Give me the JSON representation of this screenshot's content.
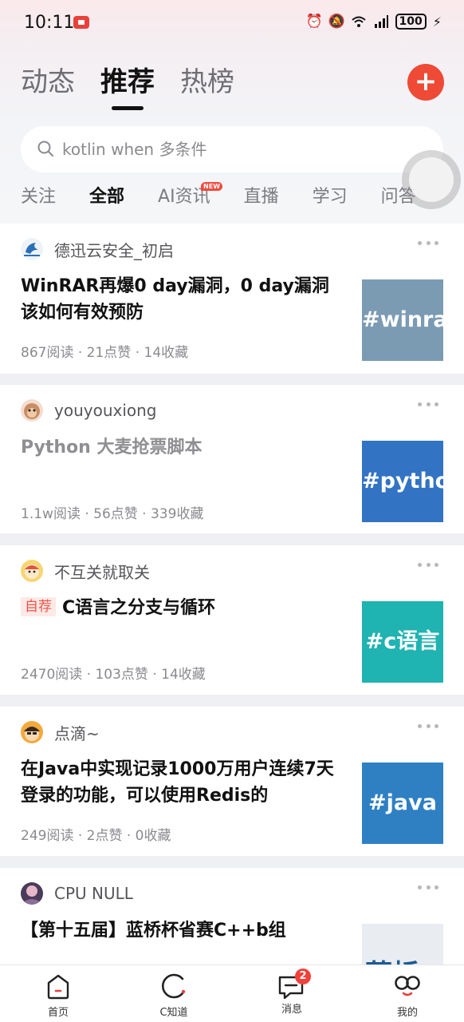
{
  "status_bar": {
    "time": "10:11",
    "battery": "100"
  },
  "main_tabs": [
    {
      "label": "动态",
      "active": false
    },
    {
      "label": "推荐",
      "active": true
    },
    {
      "label": "热榜",
      "active": false
    }
  ],
  "search": {
    "placeholder": "kotlin when 多条件"
  },
  "category_tabs": [
    {
      "label": "关注",
      "active": false
    },
    {
      "label": "全部",
      "active": true
    },
    {
      "label": "AI资讯",
      "active": false,
      "badge": "NEW"
    },
    {
      "label": "直播",
      "active": false
    },
    {
      "label": "学习",
      "active": false
    },
    {
      "label": "问答",
      "active": false
    }
  ],
  "feed": [
    {
      "author": "德迅云安全_初启",
      "title": "WinRAR再爆0 day漏洞，0 day漏洞该如何有效预防",
      "stats": "867阅读 · 21点赞 · 14收藏",
      "thumb_text": "#winrar",
      "thumb_color": "#7b9bb3"
    },
    {
      "author": "youyouxiong",
      "title": "Python 大麦抢票脚本",
      "stats": "1.1w阅读 · 56点赞 · 339收藏",
      "thumb_text": "#python",
      "thumb_color": "#3273c3"
    },
    {
      "author": "不互关就取关",
      "tag": "自荐",
      "title": "C语言之分支与循环",
      "stats": "2470阅读 · 103点赞 · 14收藏",
      "thumb_text": "#c语言",
      "thumb_color": "#1fb3b1"
    },
    {
      "author": "点滴~",
      "title": "在Java中实现记录1000万用户连续7天登录的功能，可以使用Redis的",
      "stats": "249阅读 · 2点赞 · 0收藏",
      "thumb_text": "#java",
      "thumb_color": "#2e80c3"
    },
    {
      "author": "CPU NULL",
      "title": "【第十五届】蓝桥杯省赛C++b组",
      "thumb_text": "蓝桥",
      "thumb_color": "#e9edf2"
    }
  ],
  "bottom_nav": [
    {
      "label": "首页",
      "icon": "home-icon"
    },
    {
      "label": "C知道",
      "icon": "c-know-icon"
    },
    {
      "label": "消息",
      "icon": "message-icon",
      "badge": "2"
    },
    {
      "label": "我的",
      "icon": "profile-icon"
    }
  ],
  "colors": {
    "accent": "#ee4a35",
    "badge": "#f0413a"
  }
}
